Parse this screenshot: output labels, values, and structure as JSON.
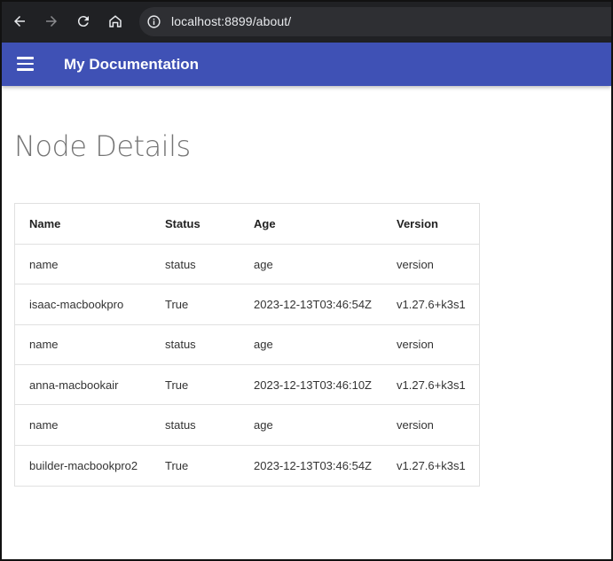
{
  "browser": {
    "url": "localhost:8899/about/",
    "icons": [
      "back-arrow-icon",
      "forward-arrow-icon",
      "reload-icon",
      "home-icon",
      "info-icon"
    ]
  },
  "header": {
    "title": "My Documentation",
    "menu_icon": "hamburger-menu-icon"
  },
  "main": {
    "title": "Node Details",
    "table": {
      "columns": [
        "Name",
        "Status",
        "Age",
        "Version"
      ],
      "rows": [
        [
          "name",
          "status",
          "age",
          "version"
        ],
        [
          "isaac-macbookpro",
          "True",
          "2023-12-13T03:46:54Z",
          "v1.27.6+k3s1"
        ],
        [
          "name",
          "status",
          "age",
          "version"
        ],
        [
          "anna-macbookair",
          "True",
          "2023-12-13T03:46:10Z",
          "v1.27.6+k3s1"
        ],
        [
          "name",
          "status",
          "age",
          "version"
        ],
        [
          "builder-macbookpro2",
          "True",
          "2023-12-13T03:46:54Z",
          "v1.27.6+k3s1"
        ]
      ]
    }
  },
  "colors": {
    "header_bg": "#3f51b5",
    "browser_bg": "#202124",
    "address_bg": "#2e2f33"
  }
}
